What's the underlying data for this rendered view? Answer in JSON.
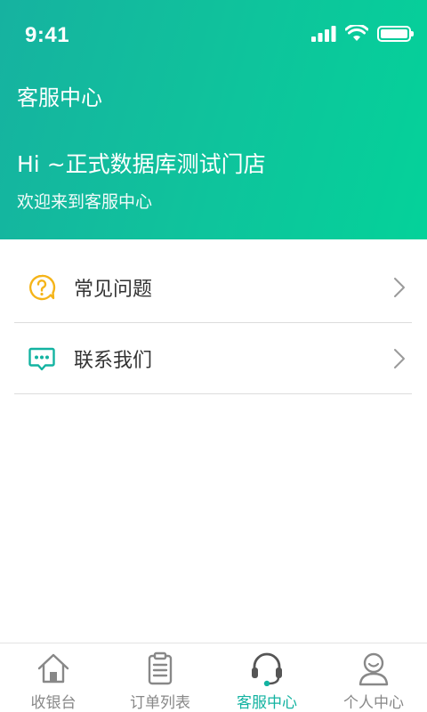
{
  "status_bar": {
    "time": "9:41"
  },
  "header": {
    "title": "客服中心",
    "greeting": "Hi ~正式数据库测试门店",
    "subtitle": "欢迎来到客服中心"
  },
  "menu": [
    {
      "label": "常见问题",
      "icon": "question-bubble-icon",
      "color": "#f5b419"
    },
    {
      "label": "联系我们",
      "icon": "chat-bubble-icon",
      "color": "#13b3a1"
    }
  ],
  "tabbar": {
    "active_color": "#13b3a1",
    "inactive_color": "#888888",
    "tabs": [
      {
        "label": "收银台",
        "icon": "home-icon",
        "active": false
      },
      {
        "label": "订单列表",
        "icon": "clipboard-icon",
        "active": false
      },
      {
        "label": "客服中心",
        "icon": "headset-icon",
        "active": true
      },
      {
        "label": "个人中心",
        "icon": "person-icon",
        "active": false
      }
    ]
  }
}
